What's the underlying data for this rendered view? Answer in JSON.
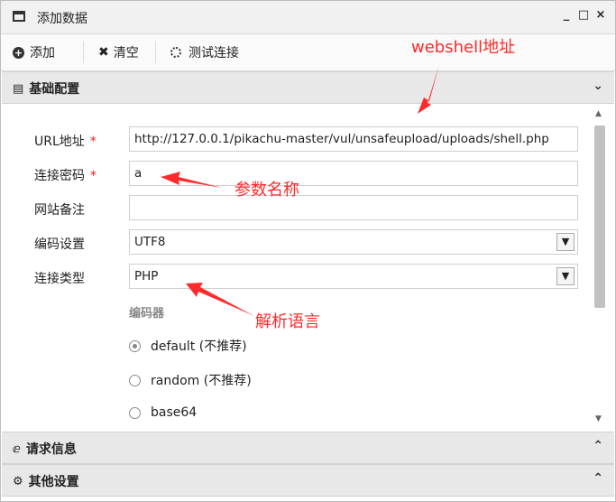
{
  "window": {
    "title": "添加数据",
    "controls": [
      "_",
      "□",
      "×"
    ]
  },
  "toolbar": {
    "add_label": "添加",
    "clear_label": "清空",
    "test_label": "测试连接"
  },
  "sections": {
    "basic": "基础配置",
    "request": "请求信息",
    "other": "其他设置"
  },
  "form": {
    "url": {
      "label": "URL地址",
      "required": "*",
      "value": "http://127.0.0.1/pikachu-master/vul/unsafeupload/uploads/shell.php"
    },
    "password": {
      "label": "连接密码",
      "required": "*",
      "value": "a"
    },
    "note": {
      "label": "网站备注",
      "value": ""
    },
    "encoding": {
      "label": "编码设置",
      "value": "UTF8"
    },
    "conn_type": {
      "label": "连接类型",
      "value": "PHP"
    },
    "encoder": {
      "title": "编码器",
      "options": [
        {
          "label": "default (不推荐)",
          "selected": true
        },
        {
          "label": "random (不推荐)",
          "selected": false
        },
        {
          "label": "base64",
          "selected": false
        }
      ]
    }
  },
  "annotations": {
    "webshell": "webshell地址",
    "param": "参数名称",
    "lang": "解析语言",
    "color": "#ff2a2a"
  },
  "icons": {
    "window": "window-icon",
    "add": "plus-circle-icon",
    "clear": "x-icon",
    "test": "spinner-icon",
    "basic": "document-icon",
    "request": "e-icon",
    "other": "gears-icon"
  }
}
